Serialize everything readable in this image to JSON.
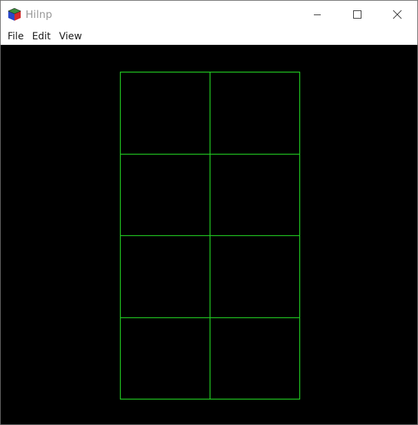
{
  "window": {
    "title": "Hilnp",
    "app_icon": "cube-icon",
    "controls": {
      "minimize_icon": "minimize-icon",
      "maximize_icon": "maximize-icon",
      "close_icon": "close-icon"
    }
  },
  "menu": {
    "items": [
      {
        "label": "File"
      },
      {
        "label": "Edit"
      },
      {
        "label": "View"
      }
    ]
  },
  "canvas": {
    "background": "#000000",
    "grid_color": "#22cc22",
    "grid": {
      "columns": 2,
      "rows": 4
    }
  }
}
